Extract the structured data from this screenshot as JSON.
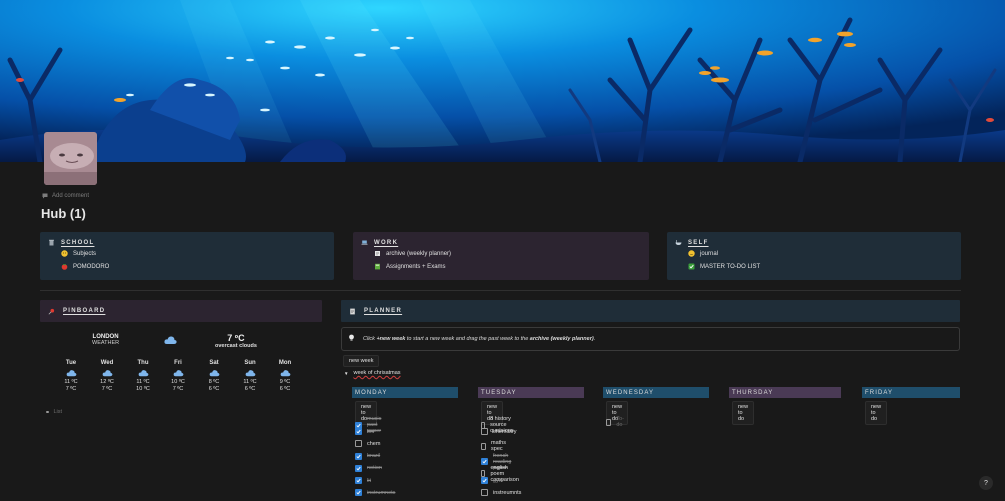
{
  "page": {
    "title": "Hub (1)",
    "add_comment": "Add comment"
  },
  "links": {
    "school": {
      "title": "SCHOOL",
      "items": [
        "Subjects",
        "POMODORO"
      ]
    },
    "work": {
      "title": "WORK",
      "items": [
        "archive (weekly planner)",
        "Assignments + Exams"
      ]
    },
    "self": {
      "title": "SELF",
      "items": [
        "journal",
        "MASTER TO-DO LIST"
      ]
    }
  },
  "pinboard": {
    "title": "PINBOARD",
    "weather": {
      "city": "LONDON",
      "label": "WEATHER",
      "temp": "7 ºC",
      "condition": "overcast clouds",
      "days": [
        {
          "name": "Tue",
          "high": "11 ºC",
          "low": "7 ºC"
        },
        {
          "name": "Wed",
          "high": "12 ºC",
          "low": "7 ºC"
        },
        {
          "name": "Thu",
          "high": "11 ºC",
          "low": "10 ºC"
        },
        {
          "name": "Fri",
          "high": "10 ºC",
          "low": "7 ºC"
        },
        {
          "name": "Sat",
          "high": "8 ºC",
          "low": "6 ºC"
        },
        {
          "name": "Sun",
          "high": "11 ºC",
          "low": "6 ºC"
        },
        {
          "name": "Mon",
          "high": "9 ºC",
          "low": "6 ºC"
        }
      ]
    },
    "list_placeholder": "List"
  },
  "planner": {
    "title": "PLANNER",
    "callout_parts": [
      "Click ",
      "+new week",
      " to start a new week and drag the past week to the ",
      "archive (weekly planner)",
      "."
    ],
    "new_week_button": "new week",
    "week_toggle": "week of chrisatmas",
    "columns": [
      {
        "name": "MONDAY",
        "button": "new to do",
        "color": "#1f4e6b",
        "todos": [
          {
            "text": "music past paper",
            "checked": true
          },
          {
            "text": "bio",
            "checked": true
          },
          {
            "text": "chem",
            "checked": false
          },
          {
            "text": "brazil",
            "checked": true
          },
          {
            "text": "notion",
            "checked": true
          },
          {
            "text": "lit",
            "checked": true
          },
          {
            "text": "instrumnets",
            "checked": true
          }
        ]
      },
      {
        "name": "TUESDAY",
        "button": "new to do",
        "color": "#4a3a55",
        "todos": [
          {
            "text": "3 history source quetsions",
            "checked": false
          },
          {
            "text": "chemistry",
            "checked": false
          },
          {
            "text": "maths spec",
            "checked": false
          },
          {
            "text": "french reading paper",
            "checked": true
          },
          {
            "text": "english poem comparison",
            "checked": false
          },
          {
            "text": "gym",
            "checked": true
          },
          {
            "text": "instreumnts",
            "checked": false
          }
        ]
      },
      {
        "name": "WEDNESDAY",
        "button": "new to do",
        "color": "#1f4e6b",
        "todos": [
          {
            "text": "To-do",
            "checked": false
          }
        ]
      },
      {
        "name": "THURSDAY",
        "button": "new to do",
        "color": "#4a3a55",
        "todos": []
      },
      {
        "name": "FRIDAY",
        "button": "new to do",
        "color": "#1f4e6b",
        "todos": []
      }
    ]
  },
  "colors": {
    "card_blue": "#1f2d38",
    "card_purple": "#2c2430",
    "checkbox_checked": "#2f81d8",
    "accent_red": "#d04040"
  },
  "help": "?"
}
